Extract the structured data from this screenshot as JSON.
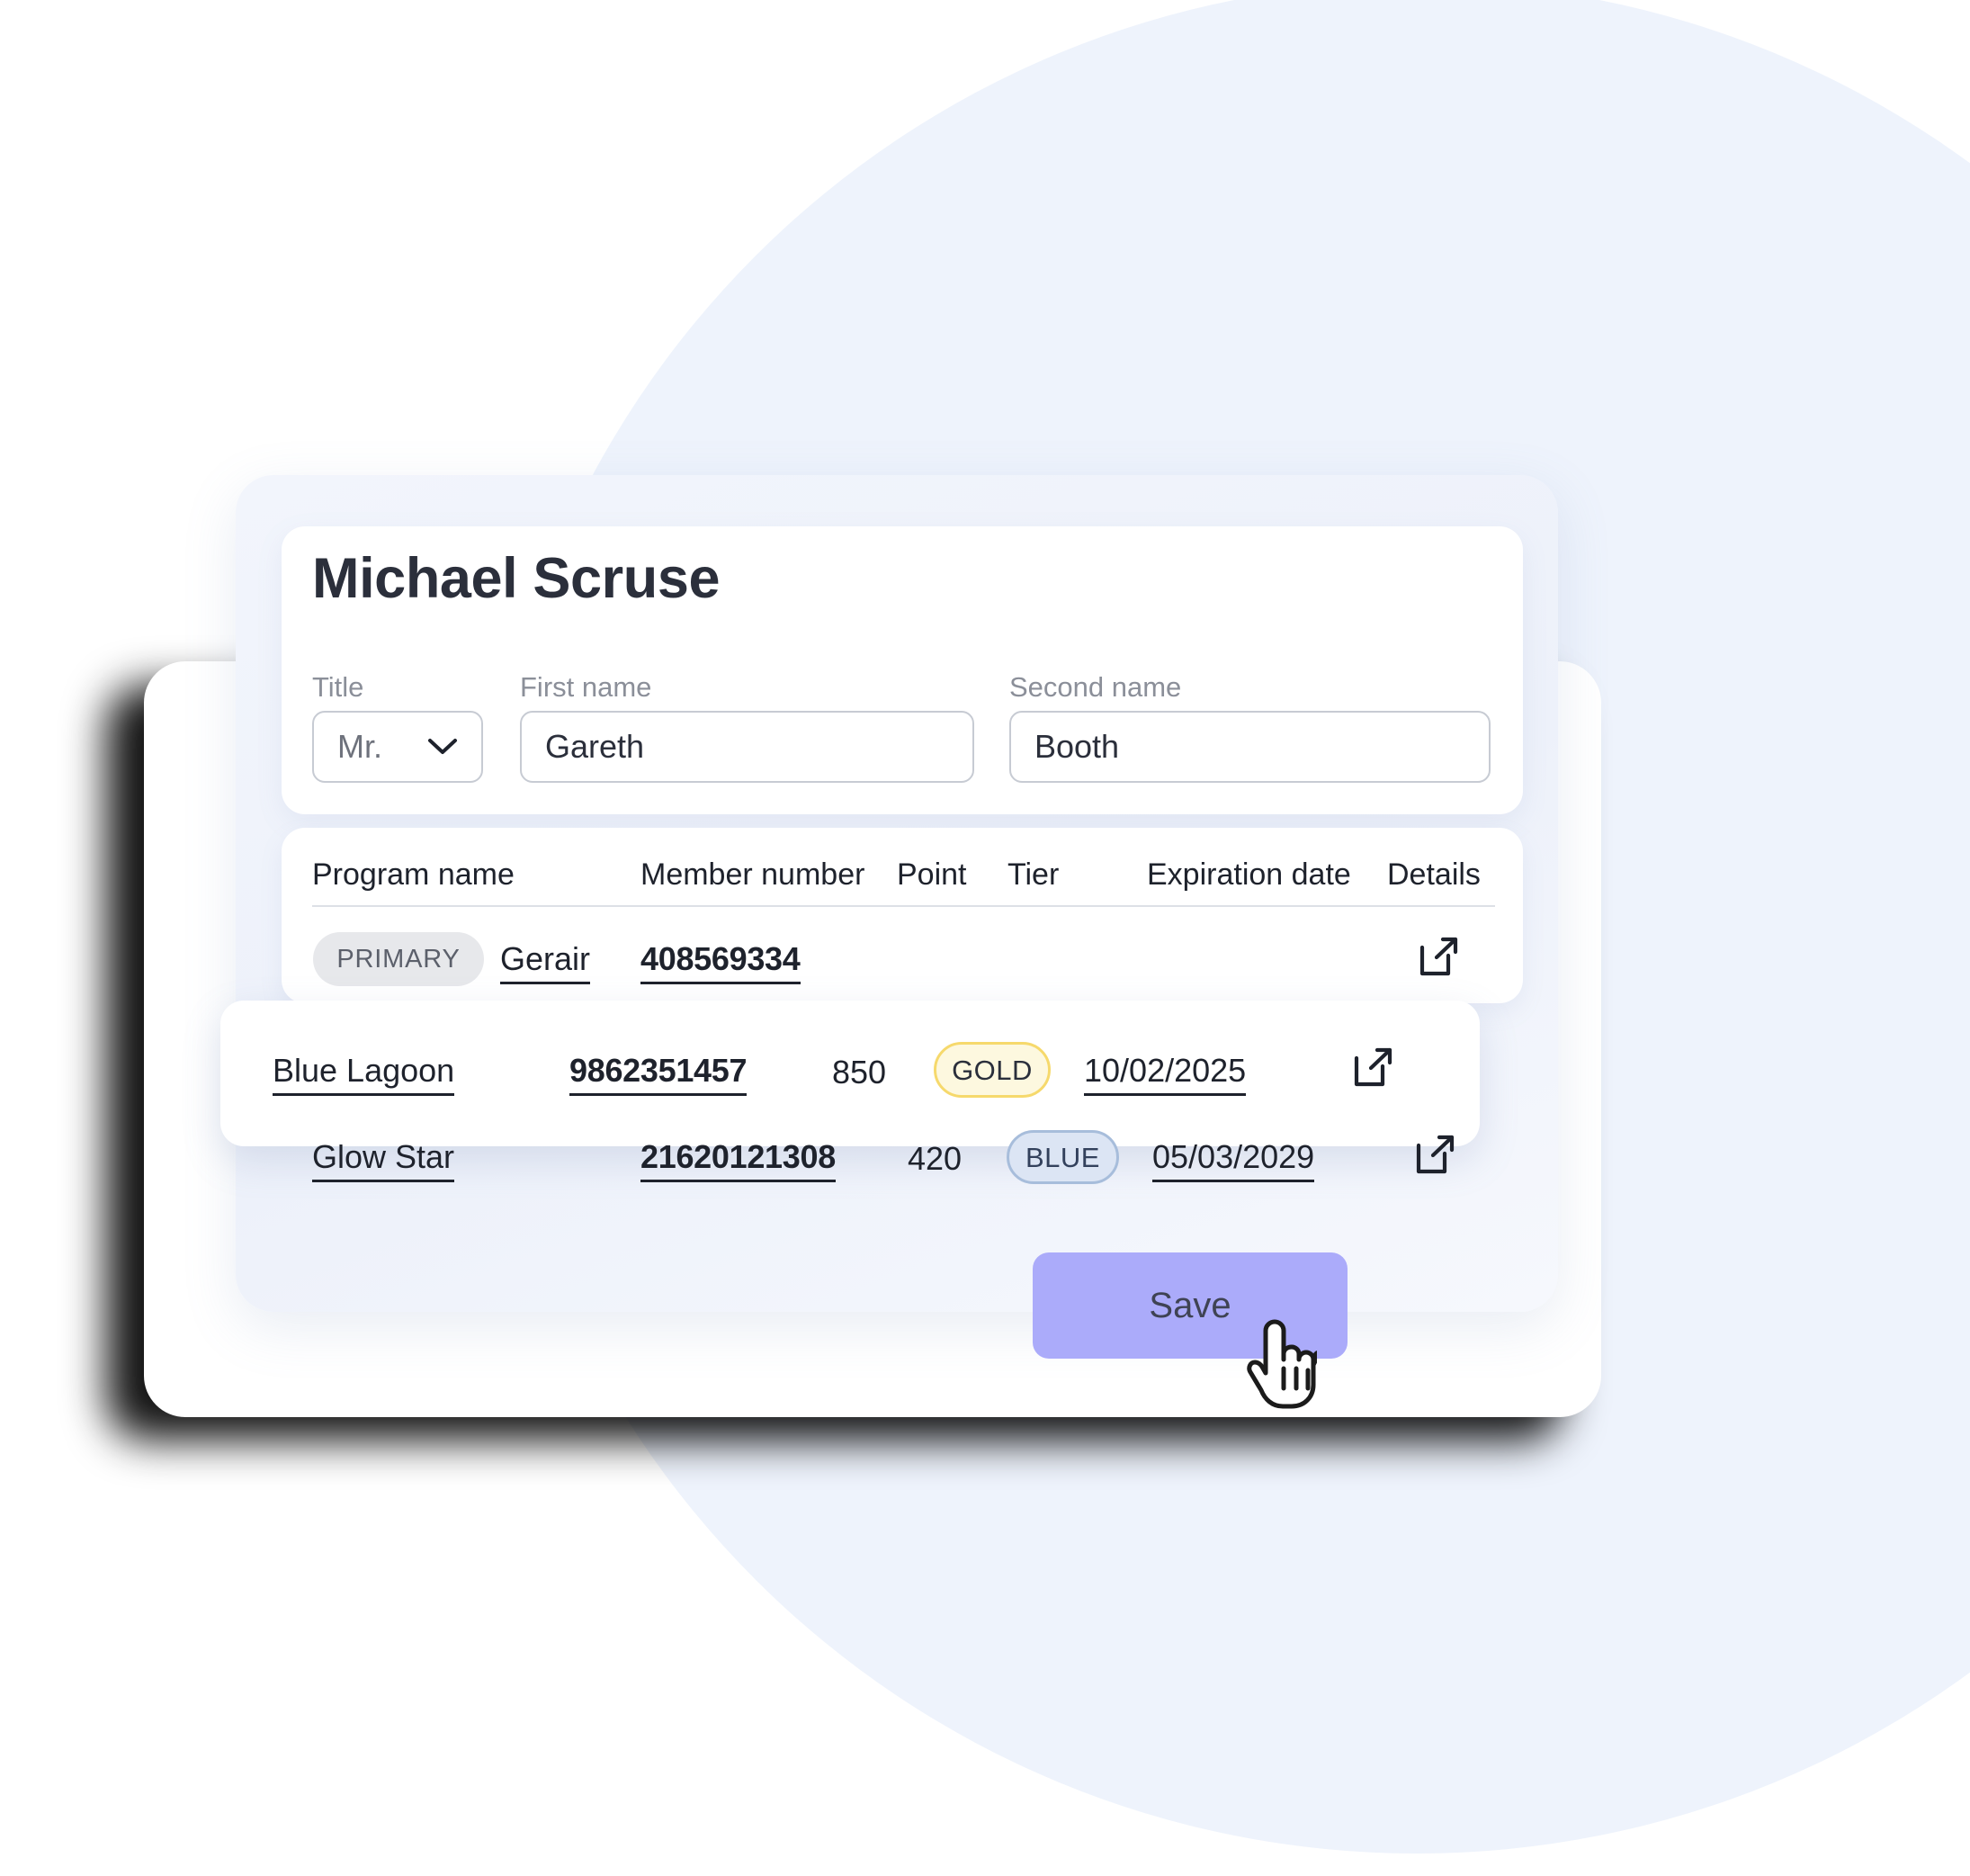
{
  "theme": {
    "background_circle": "#EEF3FC",
    "card_white": "#FFFFFF",
    "accent_purple": "#ABABFA",
    "text_dark": "#1E222C",
    "text_muted": "#8B8F99",
    "gold_badge_bg": "#FDF8DF",
    "gold_badge_border": "#F6D96C",
    "blue_badge_bg": "#DCE5F4",
    "blue_badge_border": "#A7BDDB",
    "primary_badge_bg": "#E7E8EB"
  },
  "profile": {
    "full_name": "Michael Scruse",
    "fields": [
      {
        "label": "Title",
        "value": "Mr.",
        "type": "select",
        "icon": "chevron-down-icon"
      },
      {
        "label": "First name",
        "value": "Gareth",
        "type": "text",
        "placeholder": "First name"
      },
      {
        "label": "Second name",
        "value": "Booth",
        "type": "text",
        "placeholder": "Second name"
      }
    ],
    "title_options": [
      "Mr."
    ]
  },
  "programs_table": {
    "columns": [
      "Program name",
      "Member number",
      "Point",
      "Tier",
      "Expiration date",
      "Details"
    ],
    "rows": [
      {
        "badge": "PRIMARY",
        "program_name": "Gerair",
        "member_number": "408569334",
        "point": "",
        "tier": "",
        "expiration_date": "",
        "details_icon": "external-link-icon",
        "highlighted": false
      },
      {
        "badge": "",
        "program_name": "Blue Lagoon",
        "member_number": "9862351457",
        "point": "850",
        "tier": "GOLD",
        "expiration_date": "10/02/2025",
        "details_icon": "external-link-icon",
        "highlighted": true
      },
      {
        "badge": "",
        "program_name": "Glow Star",
        "member_number": "21620121308",
        "point": "420",
        "tier": "BLUE",
        "expiration_date": "05/03/2029",
        "details_icon": "external-link-icon",
        "highlighted": false
      }
    ]
  },
  "actions": {
    "save_label": "Save"
  },
  "cursor": {
    "type": "pointing-hand-cursor"
  }
}
